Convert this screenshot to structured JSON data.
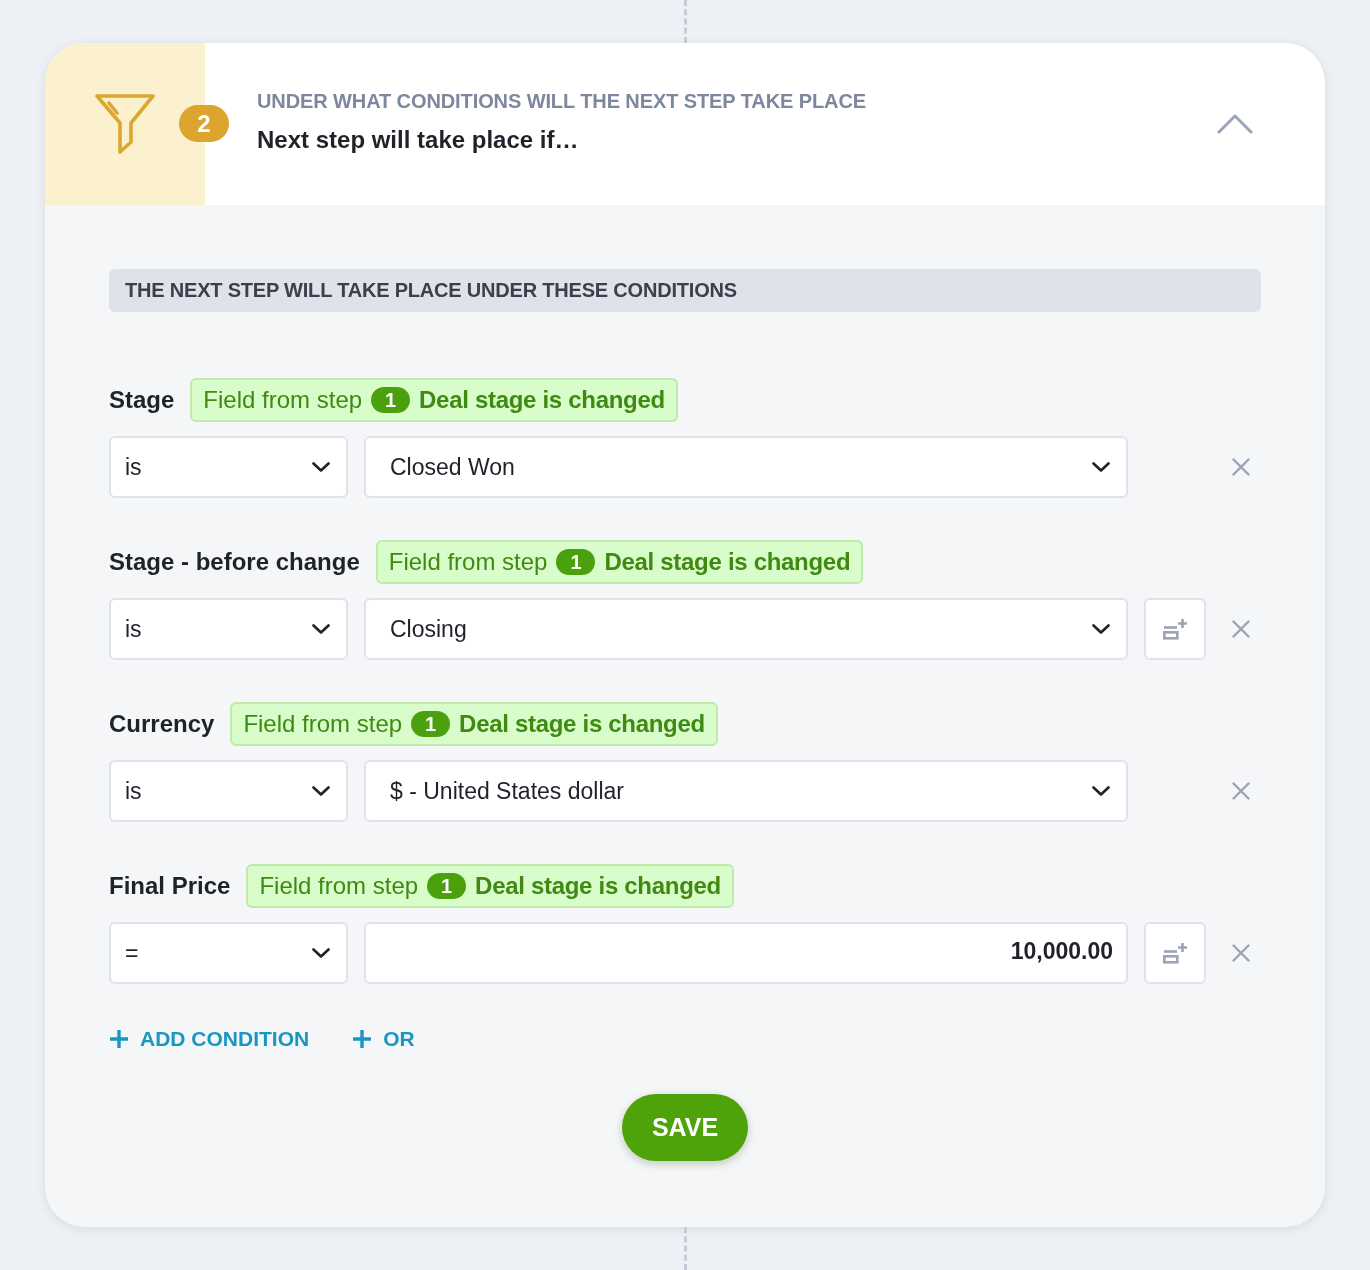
{
  "header": {
    "step_number": "2",
    "subtitle": "UNDER WHAT CONDITIONS WILL THE NEXT STEP TAKE PLACE",
    "title": "Next step will take place if…",
    "expanded": true
  },
  "section_title": "THE NEXT STEP WILL TAKE PLACE UNDER THESE CONDITIONS",
  "conditions": [
    {
      "label": "Stage",
      "source": {
        "prefix": "Field from step",
        "step": "1",
        "event": "Deal stage is changed"
      },
      "operator": "is",
      "kind": "select",
      "value": "Closed Won",
      "field_button": false
    },
    {
      "label": "Stage - before change",
      "source": {
        "prefix": "Field from step",
        "step": "1",
        "event": "Deal stage is changed"
      },
      "operator": "is",
      "kind": "select",
      "value": "Closing",
      "field_button": true
    },
    {
      "label": "Currency",
      "source": {
        "prefix": "Field from step",
        "step": "1",
        "event": "Deal stage is changed"
      },
      "operator": "is",
      "kind": "select",
      "value": "$ - United States dollar",
      "field_button": false
    },
    {
      "label": "Final Price",
      "source": {
        "prefix": "Field from step",
        "step": "1",
        "event": "Deal stage is changed"
      },
      "operator": "=",
      "kind": "input",
      "value": "10,000.00",
      "field_button": true
    }
  ],
  "actions": [
    {
      "label": "ADD CONDITION"
    },
    {
      "label": "OR"
    }
  ],
  "save_button": "SAVE"
}
